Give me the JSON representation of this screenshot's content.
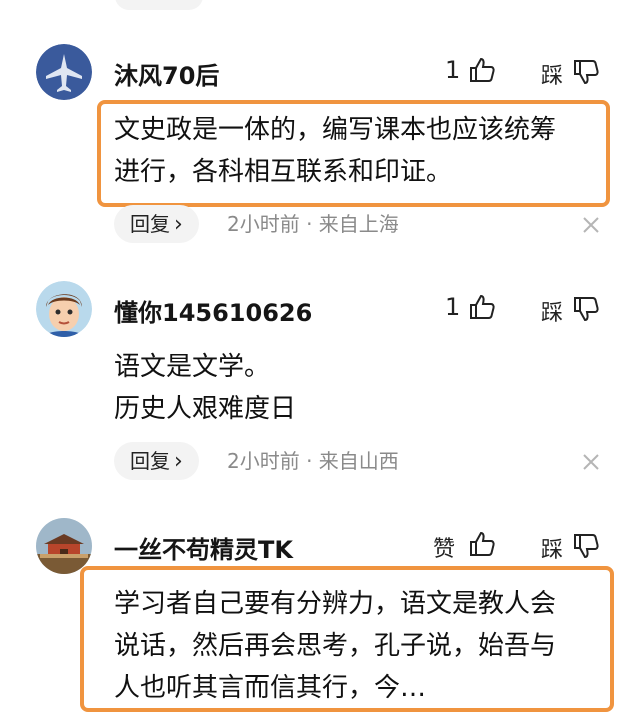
{
  "comments": [
    {
      "username": "沐风70后",
      "likes": "1",
      "dislike_label": "踩",
      "body_lines": [
        "文史政是一体的，编写课本也应该统筹",
        "进行，各科相互联系和印证。"
      ],
      "reply_label": "回复",
      "meta": "2小时前 · 来自上海",
      "avatar_icon": "jet-avatar-icon"
    },
    {
      "username": "懂你145610626",
      "likes": "1",
      "dislike_label": "踩",
      "body_lines": [
        "语文是文学。",
        "历史人艰难度日"
      ],
      "reply_label": "回复",
      "meta": "2小时前 · 来自山西",
      "avatar_icon": "cartoon-face-avatar-icon"
    },
    {
      "username": "一丝不苟精灵TK",
      "likes": "赞",
      "dislike_label": "踩",
      "body_lines": [
        "学习者自己要有分辨力，语文是教人会",
        "说话，然后再会思考，孔子说，始吾与",
        "人也听其言而信其行，今…"
      ],
      "avatar_icon": "palace-avatar-icon"
    }
  ],
  "colors": {
    "highlight": "#f0943f",
    "meta": "#8a8a8a",
    "pill": "#f3f3f3"
  }
}
